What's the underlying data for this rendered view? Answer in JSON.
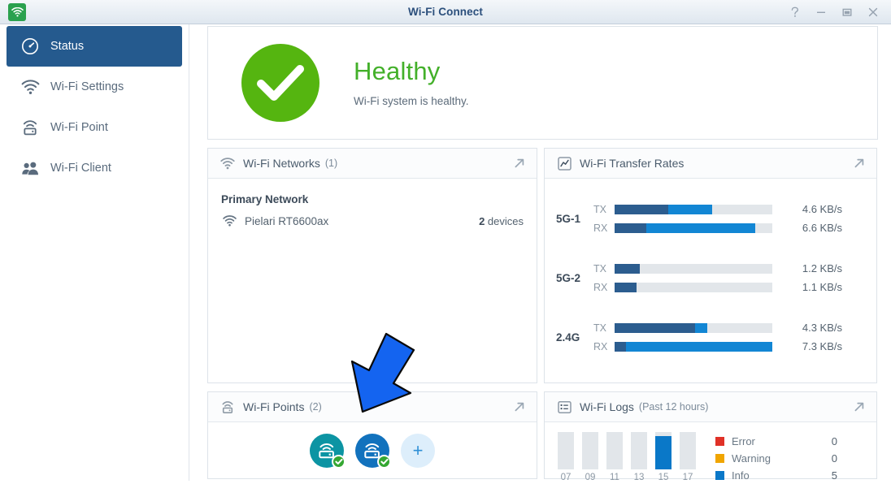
{
  "window": {
    "title": "Wi-Fi Connect",
    "app_icon": "wifi-icon",
    "controls": [
      {
        "name": "help",
        "glyph": "?"
      },
      {
        "name": "minimize",
        "glyph": "–"
      },
      {
        "name": "maximize",
        "glyph": "□"
      },
      {
        "name": "close",
        "glyph": "✕"
      }
    ]
  },
  "sidebar": {
    "items": [
      {
        "label": "Status",
        "icon": "gauge-icon",
        "active": true
      },
      {
        "label": "Wi-Fi Settings",
        "icon": "wifi-icon",
        "active": false
      },
      {
        "label": "Wi-Fi Point",
        "icon": "access-point-icon",
        "active": false
      },
      {
        "label": "Wi-Fi Client",
        "icon": "users-icon",
        "active": false
      }
    ]
  },
  "health": {
    "icon": "check-circle-icon",
    "title": "Healthy",
    "subtitle": "Wi-Fi system is healthy.",
    "color": "#43b02a"
  },
  "networks": {
    "icon": "wifi-icon",
    "title": "Wi-Fi Networks",
    "count": "(1)",
    "expand_icon": "expand-arrow-icon",
    "group_label": "Primary Network",
    "rows": [
      {
        "icon": "wifi-icon",
        "name": "Pielari RT6600ax",
        "devices_value": "2",
        "devices_label": "devices"
      }
    ]
  },
  "rates": {
    "icon": "trend-chart-icon",
    "title": "Wi-Fi Transfer Rates",
    "expand_icon": "expand-arrow-icon",
    "groups": [
      {
        "band": "5G-1",
        "lines": [
          {
            "dir": "TX",
            "value": "4.6 KB/s",
            "seg_a_pct": 34,
            "seg_b_pct": 28
          },
          {
            "dir": "RX",
            "value": "6.6 KB/s",
            "seg_a_pct": 20,
            "seg_b_pct": 69
          }
        ]
      },
      {
        "band": "5G-2",
        "lines": [
          {
            "dir": "TX",
            "value": "1.2 KB/s",
            "seg_a_pct": 16,
            "seg_b_pct": 0
          },
          {
            "dir": "RX",
            "value": "1.1 KB/s",
            "seg_a_pct": 14,
            "seg_b_pct": 0
          }
        ]
      },
      {
        "band": "2.4G",
        "lines": [
          {
            "dir": "TX",
            "value": "4.3 KB/s",
            "seg_a_pct": 51,
            "seg_b_pct": 8
          },
          {
            "dir": "RX",
            "value": "7.3 KB/s",
            "seg_a_pct": 7,
            "seg_b_pct": 93
          }
        ]
      }
    ],
    "bar_colors": {
      "segment_a": "#2c5d8f",
      "segment_b": "#1286d4",
      "track": "#e2e6ea"
    }
  },
  "points": {
    "icon": "access-point-icon",
    "title": "Wi-Fi Points",
    "count": "(2)",
    "expand_icon": "expand-arrow-icon",
    "devices": [
      {
        "icon": "wifi-point-icon",
        "color": "#0c94a3",
        "status_icon": "check-badge-icon",
        "status_color": "#35a732"
      },
      {
        "icon": "wifi-point-icon",
        "color": "#1272bd",
        "status_icon": "check-badge-icon",
        "status_color": "#35a732"
      }
    ],
    "add_button": {
      "icon": "plus-icon",
      "glyph": "+"
    }
  },
  "logs": {
    "icon": "list-icon",
    "title": "Wi-Fi Logs",
    "period": "(Past 12 hours)",
    "expand_icon": "expand-arrow-icon",
    "legend": [
      {
        "label": "Error",
        "value": "0",
        "color": "#e03127"
      },
      {
        "label": "Warning",
        "value": "0",
        "color": "#f0a500"
      },
      {
        "label": "Info",
        "value": "5",
        "color": "#0a78c8"
      }
    ],
    "chart_data": {
      "type": "bar",
      "title": "Wi-Fi Logs (Past 12 hours)",
      "categories": [
        "07",
        "09",
        "11",
        "13",
        "15",
        "17"
      ],
      "series": [
        {
          "name": "Info",
          "color": "#0a78c8",
          "values": [
            0,
            0,
            0,
            0,
            5,
            0
          ]
        }
      ],
      "values": [
        0,
        0,
        0,
        0,
        5,
        0
      ],
      "fill_pct": [
        0,
        0,
        0,
        0,
        90,
        0
      ],
      "xlabel": "",
      "ylabel": "",
      "ylim": [
        0,
        5.5
      ],
      "grid": false,
      "legend_position": "right"
    }
  },
  "annotation": {
    "arrow": {
      "name": "pointer-arrow",
      "color": "#1464f0",
      "direction": "down-left"
    }
  }
}
